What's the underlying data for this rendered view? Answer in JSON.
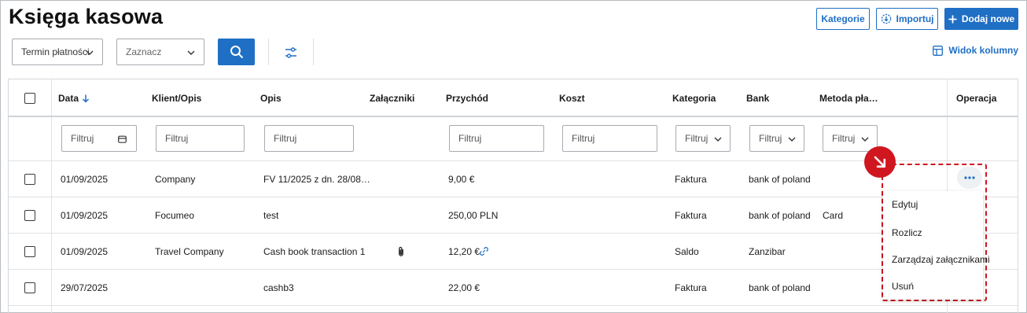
{
  "page": {
    "title": "Księga kasowa"
  },
  "toolbar": {
    "categories_label": "Kategorie",
    "import_label": "Importuj",
    "add_new_label": "Dodaj nowe",
    "due_date_select": "Termin płatności",
    "mark_select": "Zaznacz",
    "column_view_label": "Widok kolumny"
  },
  "table": {
    "headers": {
      "date": "Data",
      "client": "Klient/Opis",
      "description": "Opis",
      "attachments": "Załączniki",
      "income": "Przychód",
      "cost": "Koszt",
      "category": "Kategoria",
      "bank": "Bank",
      "method": "Metoda pła…",
      "operation": "Operacja"
    },
    "filter_placeholder": "Filtruj",
    "rows": [
      {
        "date": "01/09/2025",
        "client": "Company",
        "description": "FV 11/2025 z dn. 28/08…",
        "income": "9,00 €",
        "category": "Faktura",
        "bank": "bank of poland",
        "method": ""
      },
      {
        "date": "01/09/2025",
        "client": "Focumeo",
        "description": "test",
        "income": "250,00 PLN",
        "category": "Faktura",
        "bank": "bank of poland",
        "method": "Card"
      },
      {
        "date": "01/09/2025",
        "client": "Travel Company",
        "description": "Cash book transaction 1",
        "income": "12,20 €",
        "category": "Saldo",
        "bank": "Zanzibar",
        "method": ""
      },
      {
        "date": "29/07/2025",
        "client": "",
        "description": "cashb3",
        "income": "22,00 €",
        "category": "Faktura",
        "bank": "bank of poland",
        "method": ""
      }
    ]
  },
  "context_menu": {
    "items": [
      "Edytuj",
      "Rozlicz",
      "Zarządzaj załącznikami",
      "Usuń"
    ]
  },
  "colors": {
    "accent": "#1f6fc5",
    "highlight": "#d0161f"
  }
}
